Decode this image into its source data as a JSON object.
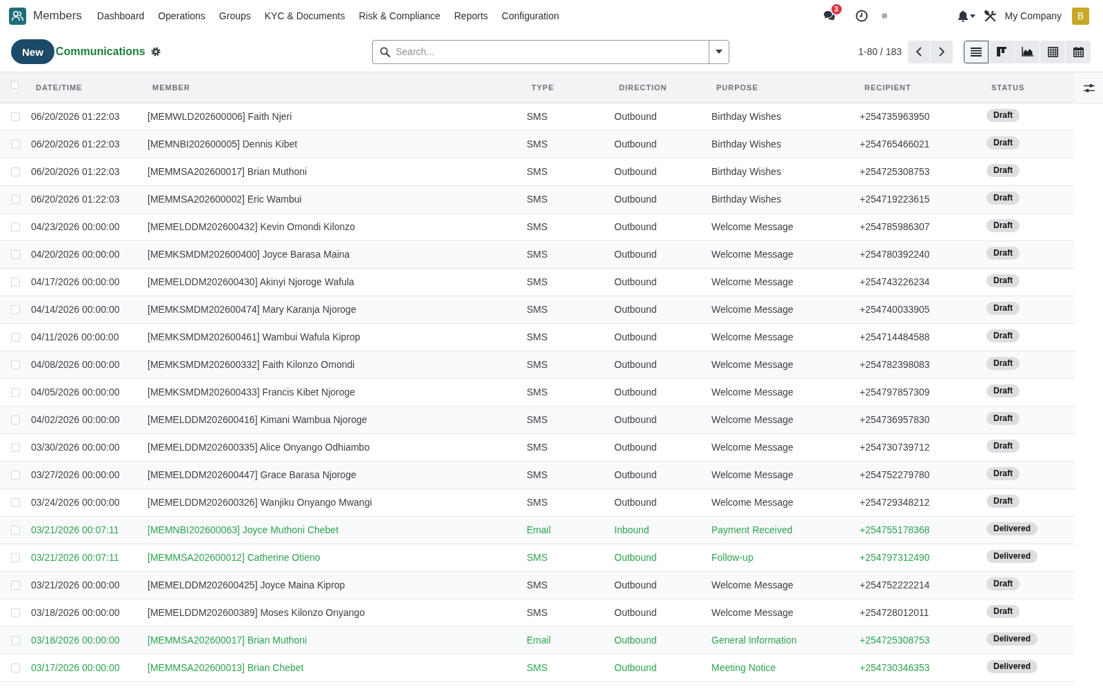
{
  "app": {
    "name": "Members"
  },
  "menu": [
    "Dashboard",
    "Operations",
    "Groups",
    "KYC & Documents",
    "Risk & Compliance",
    "Reports",
    "Configuration"
  ],
  "systray": {
    "unread_count": "3",
    "company": "My Company",
    "avatar_letter": "B"
  },
  "control_panel": {
    "new_button": "New",
    "title": "Communications",
    "search": {
      "placeholder": "Search..."
    },
    "pager": "1-80 / 183",
    "views": [
      {
        "kind": "list",
        "selected": true
      },
      {
        "kind": "kanban",
        "selected": false
      },
      {
        "kind": "graph",
        "selected": false
      },
      {
        "kind": "pivot",
        "selected": false
      },
      {
        "kind": "calendar",
        "selected": false
      }
    ]
  },
  "table": {
    "all_checked": false,
    "columns": [
      {
        "label": "DATE/TIME",
        "kind": "text"
      },
      {
        "label": "MEMBER",
        "kind": "text"
      },
      {
        "label": "TYPE",
        "kind": "text"
      },
      {
        "label": "DIRECTION",
        "kind": "text"
      },
      {
        "label": "PURPOSE",
        "kind": "text"
      },
      {
        "label": "RECIPIENT",
        "kind": "text"
      },
      {
        "label": "STATUS",
        "kind": "badge"
      }
    ],
    "rows": [
      {
        "checked": false,
        "highlighted": false,
        "cells": [
          "06/20/2026 01:22:03",
          "[MEMWLD202600006] Faith Njeri",
          "SMS",
          "Outbound",
          "Birthday Wishes",
          "+254735963950",
          "Draft"
        ]
      },
      {
        "checked": false,
        "highlighted": false,
        "cells": [
          "06/20/2026 01:22:03",
          "[MEMNBI202600005] Dennis Kibet",
          "SMS",
          "Outbound",
          "Birthday Wishes",
          "+254765466021",
          "Draft"
        ]
      },
      {
        "checked": false,
        "highlighted": false,
        "cells": [
          "06/20/2026 01:22:03",
          "[MEMMSA202600017] Brian Muthoni",
          "SMS",
          "Outbound",
          "Birthday Wishes",
          "+254725308753",
          "Draft"
        ]
      },
      {
        "checked": false,
        "highlighted": false,
        "cells": [
          "06/20/2026 01:22:03",
          "[MEMMSA202600002] Eric Wambui",
          "SMS",
          "Outbound",
          "Birthday Wishes",
          "+254719223615",
          "Draft"
        ]
      },
      {
        "checked": false,
        "highlighted": false,
        "cells": [
          "04/23/2026 00:00:00",
          "[MEMELDDM202600432] Kevin Omondi Kilonzo",
          "SMS",
          "Outbound",
          "Welcome Message",
          "+254785986307",
          "Draft"
        ]
      },
      {
        "checked": false,
        "highlighted": false,
        "cells": [
          "04/20/2026 00:00:00",
          "[MEMKSMDM202600400] Joyce Barasa Maina",
          "SMS",
          "Outbound",
          "Welcome Message",
          "+254780392240",
          "Draft"
        ]
      },
      {
        "checked": false,
        "highlighted": false,
        "cells": [
          "04/17/2026 00:00:00",
          "[MEMELDDM202600430] Akinyi Njoroge Wafula",
          "SMS",
          "Outbound",
          "Welcome Message",
          "+254743226234",
          "Draft"
        ]
      },
      {
        "checked": false,
        "highlighted": false,
        "cells": [
          "04/14/2026 00:00:00",
          "[MEMKSMDM202600474] Mary Karanja Njoroge",
          "SMS",
          "Outbound",
          "Welcome Message",
          "+254740033905",
          "Draft"
        ]
      },
      {
        "checked": false,
        "highlighted": false,
        "cells": [
          "04/11/2026 00:00:00",
          "[MEMKSMDM202600461] Wambui Wafula Kiprop",
          "SMS",
          "Outbound",
          "Welcome Message",
          "+254714484588",
          "Draft"
        ]
      },
      {
        "checked": false,
        "highlighted": false,
        "cells": [
          "04/08/2026 00:00:00",
          "[MEMKSMDM202600332] Faith Kilonzo Omondi",
          "SMS",
          "Outbound",
          "Welcome Message",
          "+254782398083",
          "Draft"
        ]
      },
      {
        "checked": false,
        "highlighted": false,
        "cells": [
          "04/05/2026 00:00:00",
          "[MEMKSMDM202600433] Francis Kibet Njoroge",
          "SMS",
          "Outbound",
          "Welcome Message",
          "+254797857309",
          "Draft"
        ]
      },
      {
        "checked": false,
        "highlighted": false,
        "cells": [
          "04/02/2026 00:00:00",
          "[MEMELDDM202600416] Kimani Wambua Njoroge",
          "SMS",
          "Outbound",
          "Welcome Message",
          "+254736957830",
          "Draft"
        ]
      },
      {
        "checked": false,
        "highlighted": false,
        "cells": [
          "03/30/2026 00:00:00",
          "[MEMELDDM202600335] Alice Onyango Odhiambo",
          "SMS",
          "Outbound",
          "Welcome Message",
          "+254730739712",
          "Draft"
        ]
      },
      {
        "checked": false,
        "highlighted": false,
        "cells": [
          "03/27/2026 00:00:00",
          "[MEMELDDM202600447] Grace Barasa Njoroge",
          "SMS",
          "Outbound",
          "Welcome Message",
          "+254752279780",
          "Draft"
        ]
      },
      {
        "checked": false,
        "highlighted": false,
        "cells": [
          "03/24/2026 00:00:00",
          "[MEMELDDM202600326] Wanjiku Onyango Mwangi",
          "SMS",
          "Outbound",
          "Welcome Message",
          "+254729348212",
          "Draft"
        ]
      },
      {
        "checked": false,
        "highlighted": true,
        "cells": [
          "03/21/2026 00:07:11",
          "[MEMNBI202600063] Joyce Muthoni Chebet",
          "Email",
          "Inbound",
          "Payment Received",
          "+254755178368",
          "Delivered"
        ]
      },
      {
        "checked": false,
        "highlighted": true,
        "cells": [
          "03/21/2026 00:07:11",
          "[MEMMSA202600012] Catherine Otieno",
          "SMS",
          "Outbound",
          "Follow-up",
          "+254797312490",
          "Delivered"
        ]
      },
      {
        "checked": false,
        "highlighted": false,
        "cells": [
          "03/21/2026 00:00:00",
          "[MEMELDDM202600425] Joyce Maina Kiprop",
          "SMS",
          "Outbound",
          "Welcome Message",
          "+254752222214",
          "Draft"
        ]
      },
      {
        "checked": false,
        "highlighted": false,
        "cells": [
          "03/18/2026 00:00:00",
          "[MEMELDDM202600389] Moses Kilonzo Onyango",
          "SMS",
          "Outbound",
          "Welcome Message",
          "+254728012011",
          "Draft"
        ]
      },
      {
        "checked": false,
        "highlighted": true,
        "cells": [
          "03/18/2026 00:00:00",
          "[MEMMSA202600017] Brian Muthoni",
          "Email",
          "Outbound",
          "General Information",
          "+254725308753",
          "Delivered"
        ]
      },
      {
        "checked": false,
        "highlighted": true,
        "cells": [
          "03/17/2026 00:00:00",
          "[MEMMSA202600013] Brian Chebet",
          "SMS",
          "Outbound",
          "Meeting Notice",
          "+254730346353",
          "Delivered"
        ]
      }
    ]
  }
}
